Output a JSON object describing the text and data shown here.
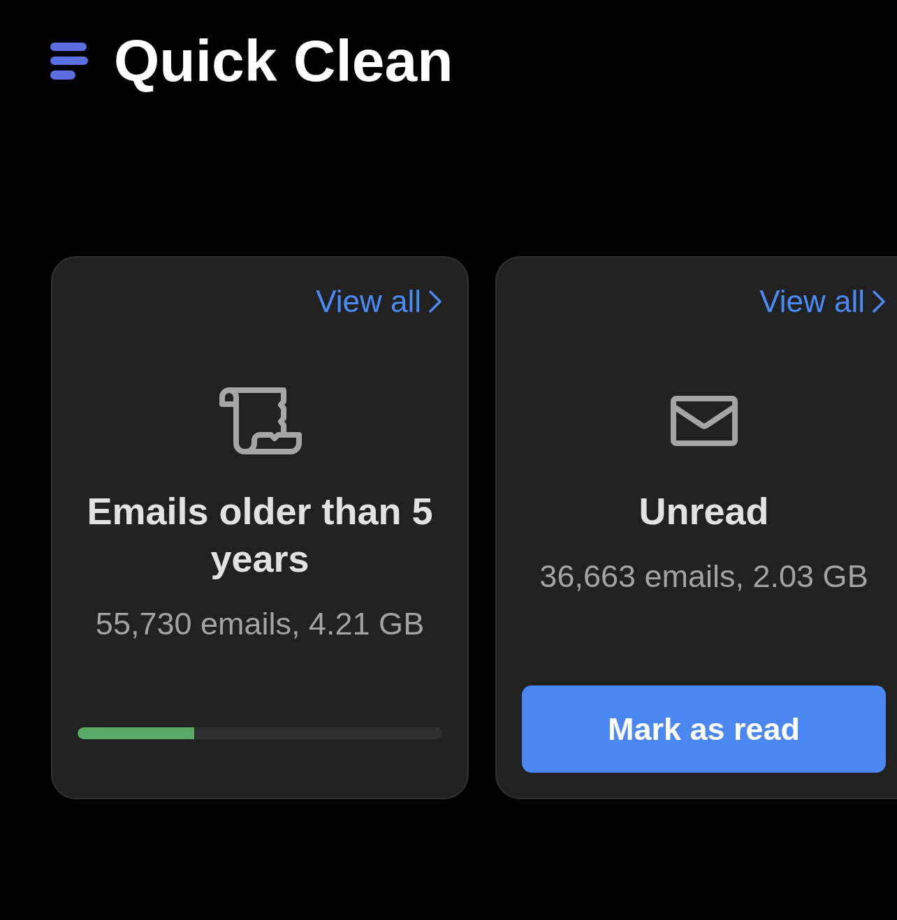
{
  "header": {
    "title": "Quick Clean"
  },
  "cards": [
    {
      "kind": "progress",
      "link": "View all",
      "title": "Emails older than 5 years",
      "summary": "55,730 emails, 4.21 GB",
      "level": 0.32
    },
    {
      "kind": "action",
      "link": "View all",
      "title": "Unread",
      "summary": "36,663 emails, 2.03 GB",
      "button": "Mark as read"
    }
  ]
}
